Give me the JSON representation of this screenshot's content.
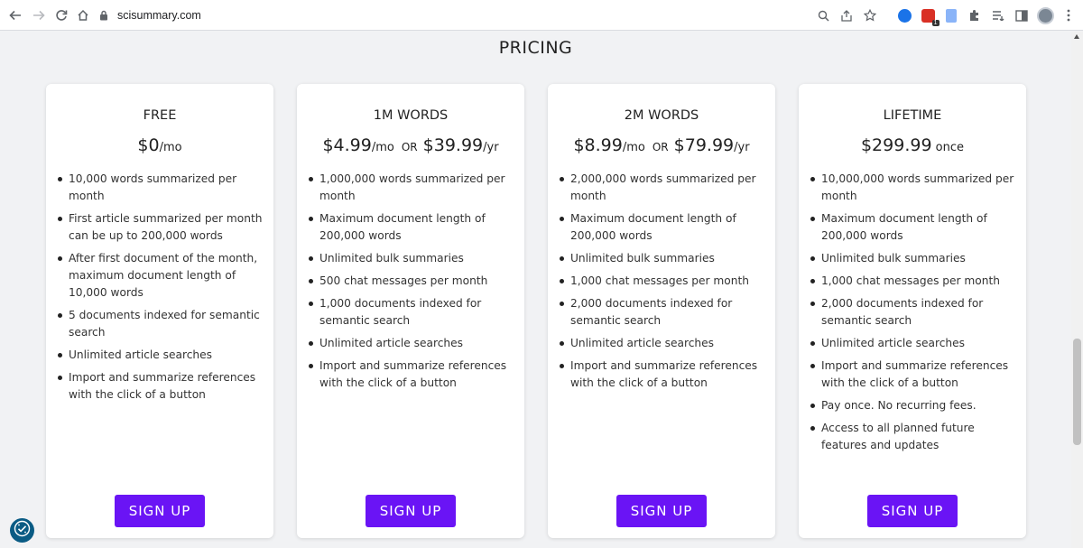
{
  "browser": {
    "url": "scisummary.com"
  },
  "page": {
    "title": "PRICING"
  },
  "plans": [
    {
      "name": "FREE",
      "price_main": "$0",
      "price_main_unit": "/mo",
      "or": "",
      "price_alt": "",
      "price_alt_unit": "",
      "features": [
        "10,000 words summarized per month",
        "First article summarized per month can be up to 200,000 words",
        "After first document of the month, maximum document length of 10,000 words",
        "5 documents indexed for semantic search",
        "Unlimited article searches",
        "Import and summarize references with the click of a button"
      ],
      "cta": "SIGN UP"
    },
    {
      "name": "1M WORDS",
      "price_main": "$4.99",
      "price_main_unit": "/mo",
      "or": "OR",
      "price_alt": "$39.99",
      "price_alt_unit": "/yr",
      "features": [
        "1,000,000 words summarized per month",
        "Maximum document length of 200,000 words",
        "Unlimited bulk summaries",
        "500 chat messages per month",
        "1,000 documents indexed for semantic search",
        "Unlimited article searches",
        "Import and summarize references with the click of a button"
      ],
      "cta": "SIGN UP"
    },
    {
      "name": "2M WORDS",
      "price_main": "$8.99",
      "price_main_unit": "/mo",
      "or": "OR",
      "price_alt": "$79.99",
      "price_alt_unit": "/yr",
      "features": [
        "2,000,000 words summarized per month",
        "Maximum document length of 200,000 words",
        "Unlimited bulk summaries",
        "1,000 chat messages per month",
        "2,000 documents indexed for semantic search",
        "Unlimited article searches",
        "Import and summarize references with the click of a button"
      ],
      "cta": "SIGN UP"
    },
    {
      "name": "LIFETIME",
      "price_main": "$299.99",
      "price_main_unit": " once",
      "or": "",
      "price_alt": "",
      "price_alt_unit": "",
      "features": [
        "10,000,000 words summarized per month",
        "Maximum document length of 200,000 words",
        "Unlimited bulk summaries",
        "1,000 chat messages per month",
        "2,000 documents indexed for semantic search",
        "Unlimited article searches",
        "Import and summarize references with the click of a button",
        "Pay once. No recurring fees.",
        "Access to all planned future features and updates"
      ],
      "cta": "SIGN UP"
    }
  ],
  "colors": {
    "accent": "#6a14f5",
    "page_background": "#f1f2f4",
    "privacy_button": "#0a5b84"
  }
}
